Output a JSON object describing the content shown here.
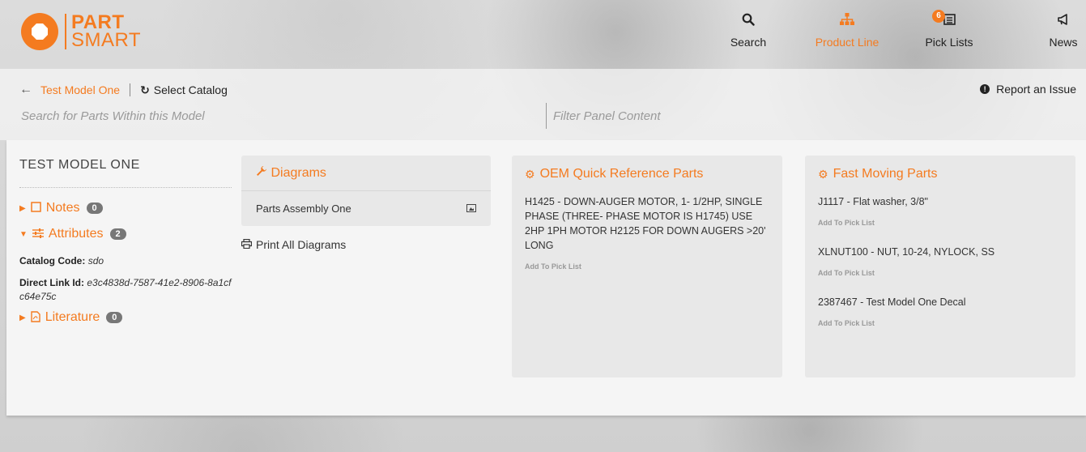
{
  "brand": {
    "line1": "PART",
    "line2": "SMART",
    "color": "#f47b20"
  },
  "nav": {
    "items": [
      {
        "label": "Search",
        "icon": "search-icon"
      },
      {
        "label": "Product Line",
        "icon": "sitemap-icon",
        "active": true
      },
      {
        "label": "Pick Lists",
        "icon": "list-icon",
        "badge": "6"
      },
      {
        "label": "News",
        "icon": "megaphone-icon"
      }
    ]
  },
  "breadcrumb": {
    "model": "Test Model One",
    "select_catalog": "Select Catalog"
  },
  "report_issue": "Report an Issue",
  "search": {
    "placeholder": "Search for Parts Within this Model"
  },
  "filter": {
    "placeholder": "Filter Panel Content"
  },
  "model_panel": {
    "title": "TEST MODEL ONE",
    "notes": {
      "label": "Notes",
      "count": "0"
    },
    "attributes": {
      "label": "Attributes",
      "count": "2"
    },
    "catalog_code": {
      "label": "Catalog Code:",
      "value": "sdo"
    },
    "direct_link": {
      "label": "Direct Link Id:",
      "value": "e3c4838d-7587-41e2-8906-8a1cfc64e75c"
    },
    "literature": {
      "label": "Literature",
      "count": "0"
    }
  },
  "diagrams": {
    "title": "Diagrams",
    "items": [
      {
        "label": "Parts Assembly One"
      }
    ],
    "print_all": "Print All Diagrams"
  },
  "oem_parts": {
    "title": "OEM Quick Reference Parts",
    "items": [
      {
        "description": "H1425 - DOWN-AUGER MOTOR, 1- 1/2HP, SINGLE PHASE (THREE- PHASE MOTOR IS H1745) USE 2HP 1PH MOTOR H2125 FOR DOWN AUGERS >20' LONG",
        "action": "Add To Pick List"
      }
    ]
  },
  "fast_parts": {
    "title": "Fast Moving Parts",
    "items": [
      {
        "description": "J1117 - Flat washer, 3/8\"",
        "action": "Add To Pick List"
      },
      {
        "description": "XLNUT100 - NUT, 10-24, NYLOCK, SS",
        "action": "Add To Pick List"
      },
      {
        "description": "2387467 - Test Model One Decal",
        "action": "Add To Pick List"
      }
    ]
  }
}
